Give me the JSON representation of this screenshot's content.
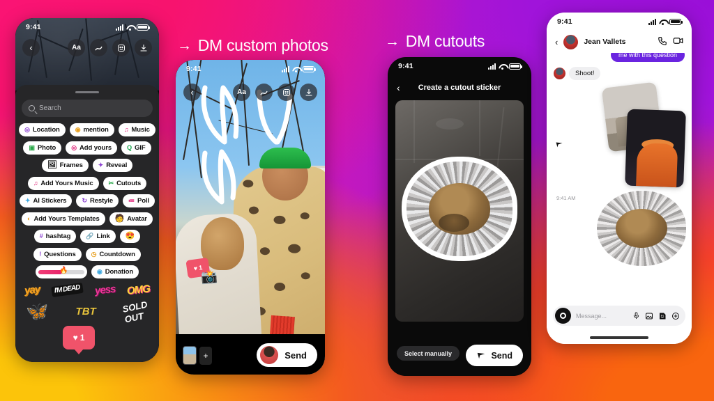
{
  "background": {
    "colors": [
      "#FA1474",
      "#9A0FD8",
      "#FCC40A",
      "#F9650F"
    ]
  },
  "headings": [
    {
      "arrow": "→",
      "text": "DM custom photos"
    },
    {
      "arrow": "→",
      "text": "DM cutouts"
    }
  ],
  "phone1": {
    "name": "sticker-tray-phone",
    "status": {
      "time": "9:41"
    },
    "top_icons": [
      "text-aa-icon",
      "draw-icon",
      "sticker-icon",
      "download-icon"
    ],
    "back_label": "‹",
    "search": {
      "placeholder": "Search"
    },
    "sticker_rows": [
      [
        {
          "icon": "◎",
          "label": "Location",
          "color": "#8A3FD1"
        },
        {
          "icon": "◉",
          "label": "mention",
          "color": "#E8A020"
        },
        {
          "icon": "♫",
          "label": "Music",
          "color": "#E0267A"
        }
      ],
      [
        {
          "icon": "▣",
          "label": "Photo",
          "color": "#2BA84A"
        },
        {
          "icon": "◎",
          "label": "Add yours",
          "color": "#E0267A"
        },
        {
          "icon": "Q",
          "label": "GIF",
          "color": "#16A34A"
        }
      ],
      [
        {
          "icon": "🖼",
          "label": "Frames",
          "color": "#444"
        },
        {
          "icon": "✦",
          "label": "Reveal",
          "color": "#8A3FD1"
        }
      ],
      [
        {
          "icon": "♫",
          "label": "Add Yours Music",
          "color": "#E0267A"
        },
        {
          "icon": "✂",
          "label": "Cutouts",
          "color": "#2BA84A"
        }
      ],
      [
        {
          "icon": "✦",
          "label": "AI Stickers",
          "color": "#3FA9E0"
        },
        {
          "icon": "↻",
          "label": "Restyle",
          "color": "#8A3FD1"
        },
        {
          "icon": "≔",
          "label": "Poll",
          "color": "#E0267A"
        }
      ],
      [
        {
          "icon": "◐",
          "label": "Add Yours Templates",
          "color": "#E8A020"
        },
        {
          "icon": "🧑",
          "label": "Avatar",
          "color": "#C0392B"
        }
      ],
      [
        {
          "icon": "#",
          "label": "hashtag",
          "color": "#8A3FD1"
        },
        {
          "icon": "🔗",
          "label": "Link",
          "color": "#3FA9E0"
        },
        {
          "icon": "😍",
          "label": "",
          "color": "#E8A020"
        }
      ],
      [
        {
          "icon": "!",
          "label": "Questions",
          "color": "#8A3FD1"
        },
        {
          "icon": "◷",
          "label": "Countdown",
          "color": "#E8A020"
        }
      ],
      [
        {
          "icon": "slider",
          "label": "",
          "color": "#E8246B"
        },
        {
          "icon": "◉",
          "label": "Donation",
          "color": "#3FA9E0"
        }
      ]
    ],
    "wordart": [
      "yay",
      "I'M DEAD",
      "yess",
      "OMG"
    ],
    "like_badge": {
      "icon": "♥",
      "count": "1"
    }
  },
  "phone2": {
    "name": "custom-photo-story-phone",
    "status": {
      "time": "9:41"
    },
    "top_icons": [
      "text-aa-icon",
      "draw-icon",
      "sticker-icon",
      "download-icon"
    ],
    "back_label": "‹",
    "like_sticker": {
      "icon": "♥",
      "count": "1"
    },
    "camera_sticker": "📸",
    "send_button": {
      "label": "Send"
    },
    "add_button": {
      "label": "+"
    }
  },
  "phone3": {
    "name": "cutout-sticker-phone",
    "status": {
      "time": "9:41"
    },
    "back_label": "‹",
    "title": "Create a cutout sticker",
    "select_manually": {
      "label": "Select manually"
    },
    "send_button": {
      "label": "Send",
      "icon": "send-plane-icon"
    }
  },
  "phone4": {
    "name": "direct-message-phone",
    "status": {
      "time": "9:41"
    },
    "back_label": "‹",
    "contact_name": "Jean Vallets",
    "header_icons": [
      "phone-call-icon",
      "video-camera-icon"
    ],
    "messages": [
      {
        "type": "outgoing",
        "text": "me with this question"
      },
      {
        "type": "incoming",
        "text": "Shoot!"
      }
    ],
    "timestamp": "9:41 AM",
    "input": {
      "placeholder": "Message...",
      "icons": [
        "camera-icon",
        "microphone-icon",
        "gallery-icon",
        "sticker-icon",
        "plus-icon"
      ]
    }
  }
}
